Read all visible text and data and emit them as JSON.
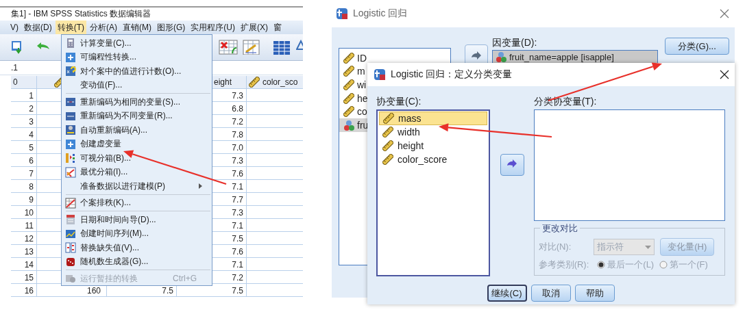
{
  "data_editor": {
    "title": "集1] - IBM SPSS Statistics 数据编辑器",
    "menu_bar": [
      {
        "label": "V)",
        "selected": false
      },
      {
        "label": "数据(D)",
        "selected": false
      },
      {
        "label": "转换(T)",
        "selected": true
      },
      {
        "label": "分析(A)",
        "selected": false
      },
      {
        "label": "直销(M)",
        "selected": false
      },
      {
        "label": "图形(G)",
        "selected": false
      },
      {
        "label": "实用程序(U)",
        "selected": false
      },
      {
        "label": "扩展(X)",
        "selected": false
      },
      {
        "label": "窗",
        "selected": false
      }
    ],
    "cell_reference": ".1",
    "columns": [
      {
        "label": "0",
        "icon": false
      },
      {
        "icon": true
      },
      {
        "label": "eight",
        "icon": false
      },
      {
        "label": "color_sco",
        "icon": true
      }
    ],
    "rows": [
      {
        "number": "1",
        "column_3": "7.3"
      },
      {
        "number": "2",
        "column_3": "6.8"
      },
      {
        "number": "3",
        "column_3": "7.2"
      },
      {
        "number": "4",
        "column_3": "7.8"
      },
      {
        "number": "5",
        "column_3": "7.0"
      },
      {
        "number": "6",
        "column_3": "7.3"
      },
      {
        "number": "7",
        "column_3": "7.6"
      },
      {
        "number": "8",
        "column_3": "7.1"
      },
      {
        "number": "9",
        "column_3": "7.7"
      },
      {
        "number": "10",
        "column_3": "7.3"
      },
      {
        "number": "11",
        "column_3": "7.1"
      },
      {
        "number": "12",
        "column_3": "7.5"
      },
      {
        "number": "13",
        "column_3": "7.6"
      },
      {
        "number": "14",
        "column_3": "7.1"
      },
      {
        "number": "15",
        "column_3": "7.2"
      },
      {
        "number": "16",
        "column_1": "160",
        "column_2": "7.5",
        "column_3": "7.5"
      }
    ],
    "transform_menu": [
      {
        "kind": "item",
        "label": "计算变量(C)...",
        "disabled": false,
        "submenu": false
      },
      {
        "kind": "item",
        "label": "可编程性转换...",
        "disabled": false,
        "submenu": false
      },
      {
        "kind": "item",
        "label": "对个案中的值进行计数(O)...",
        "disabled": false,
        "submenu": false
      },
      {
        "kind": "item",
        "label": "变动值(F)...",
        "disabled": false,
        "submenu": false
      },
      {
        "kind": "separator"
      },
      {
        "kind": "item",
        "label": "重新编码为相同的变量(S)...",
        "disabled": false,
        "submenu": false
      },
      {
        "kind": "item",
        "label": "重新编码为不同变量(R)...",
        "disabled": false,
        "submenu": false
      },
      {
        "kind": "item",
        "label": "自动重新编码(A)...",
        "disabled": false,
        "submenu": false
      },
      {
        "kind": "item",
        "label": "创建虚变量",
        "disabled": false,
        "submenu": false
      },
      {
        "kind": "item",
        "label": "可视分箱(B)...",
        "disabled": false,
        "submenu": false
      },
      {
        "kind": "item",
        "label": "最优分箱(I)...",
        "disabled": false,
        "submenu": false
      },
      {
        "kind": "item",
        "label": "准备数据以进行建模(P)",
        "disabled": false,
        "submenu": true
      },
      {
        "kind": "separator"
      },
      {
        "kind": "item",
        "label": "个案排秩(K)...",
        "disabled": false,
        "submenu": false
      },
      {
        "kind": "separator"
      },
      {
        "kind": "item",
        "label": "日期和时间向导(D)...",
        "disabled": false,
        "submenu": false
      },
      {
        "kind": "item",
        "label": "创建时间序列(M)...",
        "disabled": false,
        "submenu": false
      },
      {
        "kind": "item",
        "label": "替换缺失值(V)...",
        "disabled": false,
        "submenu": false
      },
      {
        "kind": "item",
        "label": "随机数生成器(G)...",
        "disabled": false,
        "submenu": false
      },
      {
        "kind": "separator"
      },
      {
        "kind": "item",
        "label": "运行暂挂的转换",
        "shortcut": "Ctrl+G",
        "disabled": true,
        "submenu": false
      }
    ]
  },
  "logistic_dialog": {
    "title": "Logistic 回归",
    "variables": [
      {
        "label": "ID",
        "kind": "scale",
        "selected": false
      },
      {
        "label": "m",
        "kind": "scale",
        "selected": false
      },
      {
        "label": "wi",
        "kind": "scale",
        "selected": false
      },
      {
        "label": "he",
        "kind": "scale",
        "selected": false
      },
      {
        "label": "co",
        "kind": "scale",
        "selected": false
      },
      {
        "label": "fru",
        "kind": "nominal",
        "selected": true
      }
    ],
    "dependent_label": "因变量(D):",
    "dependent_value": "fruit_name=apple [isapple]",
    "categorical_button": "分类(G)..."
  },
  "categorical_dialog": {
    "title": "Logistic 回归：定义分类变量",
    "covariates_label": "协变量(C):",
    "covariates": [
      {
        "label": "mass",
        "selected": true
      },
      {
        "label": "width",
        "selected": false
      },
      {
        "label": "height",
        "selected": false
      },
      {
        "label": "color_score",
        "selected": false
      }
    ],
    "categorical_label": "分类协变量(T):",
    "change_contrast": {
      "title": "更改对比",
      "disabled": true,
      "contrast_label": "对比(N):",
      "contrast_value": "指示符",
      "change_button": "变化量(H)",
      "reference_label": "参考类别(R):",
      "options": [
        {
          "label": "最后一个(L)",
          "selected": true
        },
        {
          "label": "第一个(F)",
          "selected": false
        }
      ]
    },
    "buttons": [
      {
        "label": "继续(C)",
        "default": true
      },
      {
        "label": "取消",
        "default": false
      },
      {
        "label": "帮助",
        "default": false
      }
    ]
  }
}
